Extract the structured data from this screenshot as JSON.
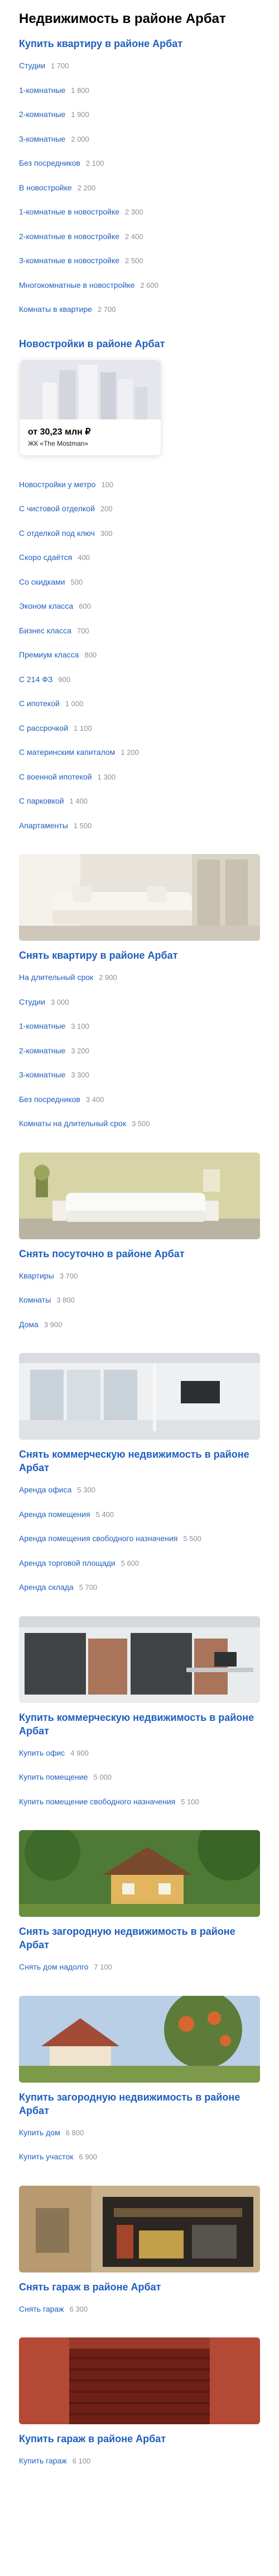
{
  "page_title": "Недвижимость в районе Арбат",
  "buy_flat": {
    "title": "Купить квартиру в районе Арбат",
    "items": [
      {
        "label": "Студии",
        "count": "1 700"
      },
      {
        "label": "1-комнатные",
        "count": "1 800"
      },
      {
        "label": "2-комнатные",
        "count": "1 900"
      },
      {
        "label": "3-комнатные",
        "count": "2 000"
      },
      {
        "label": "Без посредников",
        "count": "2 100"
      },
      {
        "label": "В новостройке",
        "count": "2 200"
      },
      {
        "label": "1-комнатные в новостройке",
        "count": "2 300"
      },
      {
        "label": "2-комнатные в новостройке",
        "count": "2 400"
      },
      {
        "label": "3-комнатные в новостройке",
        "count": "2 500"
      },
      {
        "label": "Многокомнатные в новостройке",
        "count": "2 600"
      },
      {
        "label": "Комнаты в квартире",
        "count": "2 700"
      }
    ]
  },
  "new_buildings": {
    "title": "Новостройки в районе Арбат",
    "card": {
      "price": "от 30,23 млн ₽",
      "name": "ЖК «The Mostman»"
    },
    "items": [
      {
        "label": "Новостройки у метро",
        "count": "100"
      },
      {
        "label": "С чистовой отделкой",
        "count": "200"
      },
      {
        "label": "С отделкой под ключ",
        "count": "300"
      },
      {
        "label": "Скоро сдаётся",
        "count": "400"
      },
      {
        "label": "Со скидками",
        "count": "500"
      },
      {
        "label": "Эконом класса",
        "count": "600"
      },
      {
        "label": "Бизнес класса",
        "count": "700"
      },
      {
        "label": "Премиум класса",
        "count": "800"
      },
      {
        "label": "С 214 ФЗ",
        "count": "900"
      },
      {
        "label": "С ипотекой",
        "count": "1 000"
      },
      {
        "label": "С рассрочкой",
        "count": "1 100"
      },
      {
        "label": "С материнским капиталом",
        "count": "1 200"
      },
      {
        "label": "С военной ипотекой",
        "count": "1 300"
      },
      {
        "label": "С парковкой",
        "count": "1 400"
      },
      {
        "label": "Апартаменты",
        "count": "1 500"
      }
    ]
  },
  "rent_flat": {
    "title": "Снять квартиру в районе Арбат",
    "items": [
      {
        "label": "На длительный срок",
        "count": "2 900"
      },
      {
        "label": "Студии",
        "count": "3 000"
      },
      {
        "label": "1-комнатные",
        "count": "3 100"
      },
      {
        "label": "2-комнатные",
        "count": "3 200"
      },
      {
        "label": "3-комнатные",
        "count": "3 300"
      },
      {
        "label": "Без посредников",
        "count": "3 400"
      },
      {
        "label": "Комнаты на длительный срок",
        "count": "3 500"
      }
    ]
  },
  "daily": {
    "title": "Снять посуточно в районе Арбат",
    "items": [
      {
        "label": "Квартиры",
        "count": "3 700"
      },
      {
        "label": "Комнаты",
        "count": "3 800"
      },
      {
        "label": "Дома",
        "count": "3 900"
      }
    ]
  },
  "rent_commercial": {
    "title": "Снять коммерческую недвижимость в районе Арбат",
    "items": [
      {
        "label": "Аренда офиса",
        "count": "5 300"
      },
      {
        "label": "Аренда помещения",
        "count": "5 400"
      },
      {
        "label": "Аренда помещения свободного назначения",
        "count": "5 500"
      },
      {
        "label": "Аренда торговой площади",
        "count": "5 600"
      },
      {
        "label": "Аренда склада",
        "count": "5 700"
      }
    ]
  },
  "buy_commercial": {
    "title": "Купить коммерческую недвижимость в районе Арбат",
    "items": [
      {
        "label": "Купить офис",
        "count": "4 900"
      },
      {
        "label": "Купить помещение",
        "count": "5 000"
      },
      {
        "label": "Купить помещение свободного назначения",
        "count": "5 100"
      }
    ]
  },
  "rent_country": {
    "title": "Снять загородную недвижимость в районе Арбат",
    "items": [
      {
        "label": "Снять дом надолго",
        "count": "7 100"
      }
    ]
  },
  "buy_country": {
    "title": "Купить загородную недвижимость в районе Арбат",
    "items": [
      {
        "label": "Купить дом",
        "count": "6 800"
      },
      {
        "label": "Купить участок",
        "count": "6 900"
      }
    ]
  },
  "rent_garage": {
    "title": "Снять гараж в районе Арбат",
    "items": [
      {
        "label": "Снять гараж",
        "count": "6 300"
      }
    ]
  },
  "buy_garage": {
    "title": "Купить гараж в районе Арбат",
    "items": [
      {
        "label": "Купить гараж",
        "count": "6 100"
      }
    ]
  },
  "colors": {
    "link": "#1f5fbf",
    "count": "#8a8f99",
    "title": "#000000"
  }
}
